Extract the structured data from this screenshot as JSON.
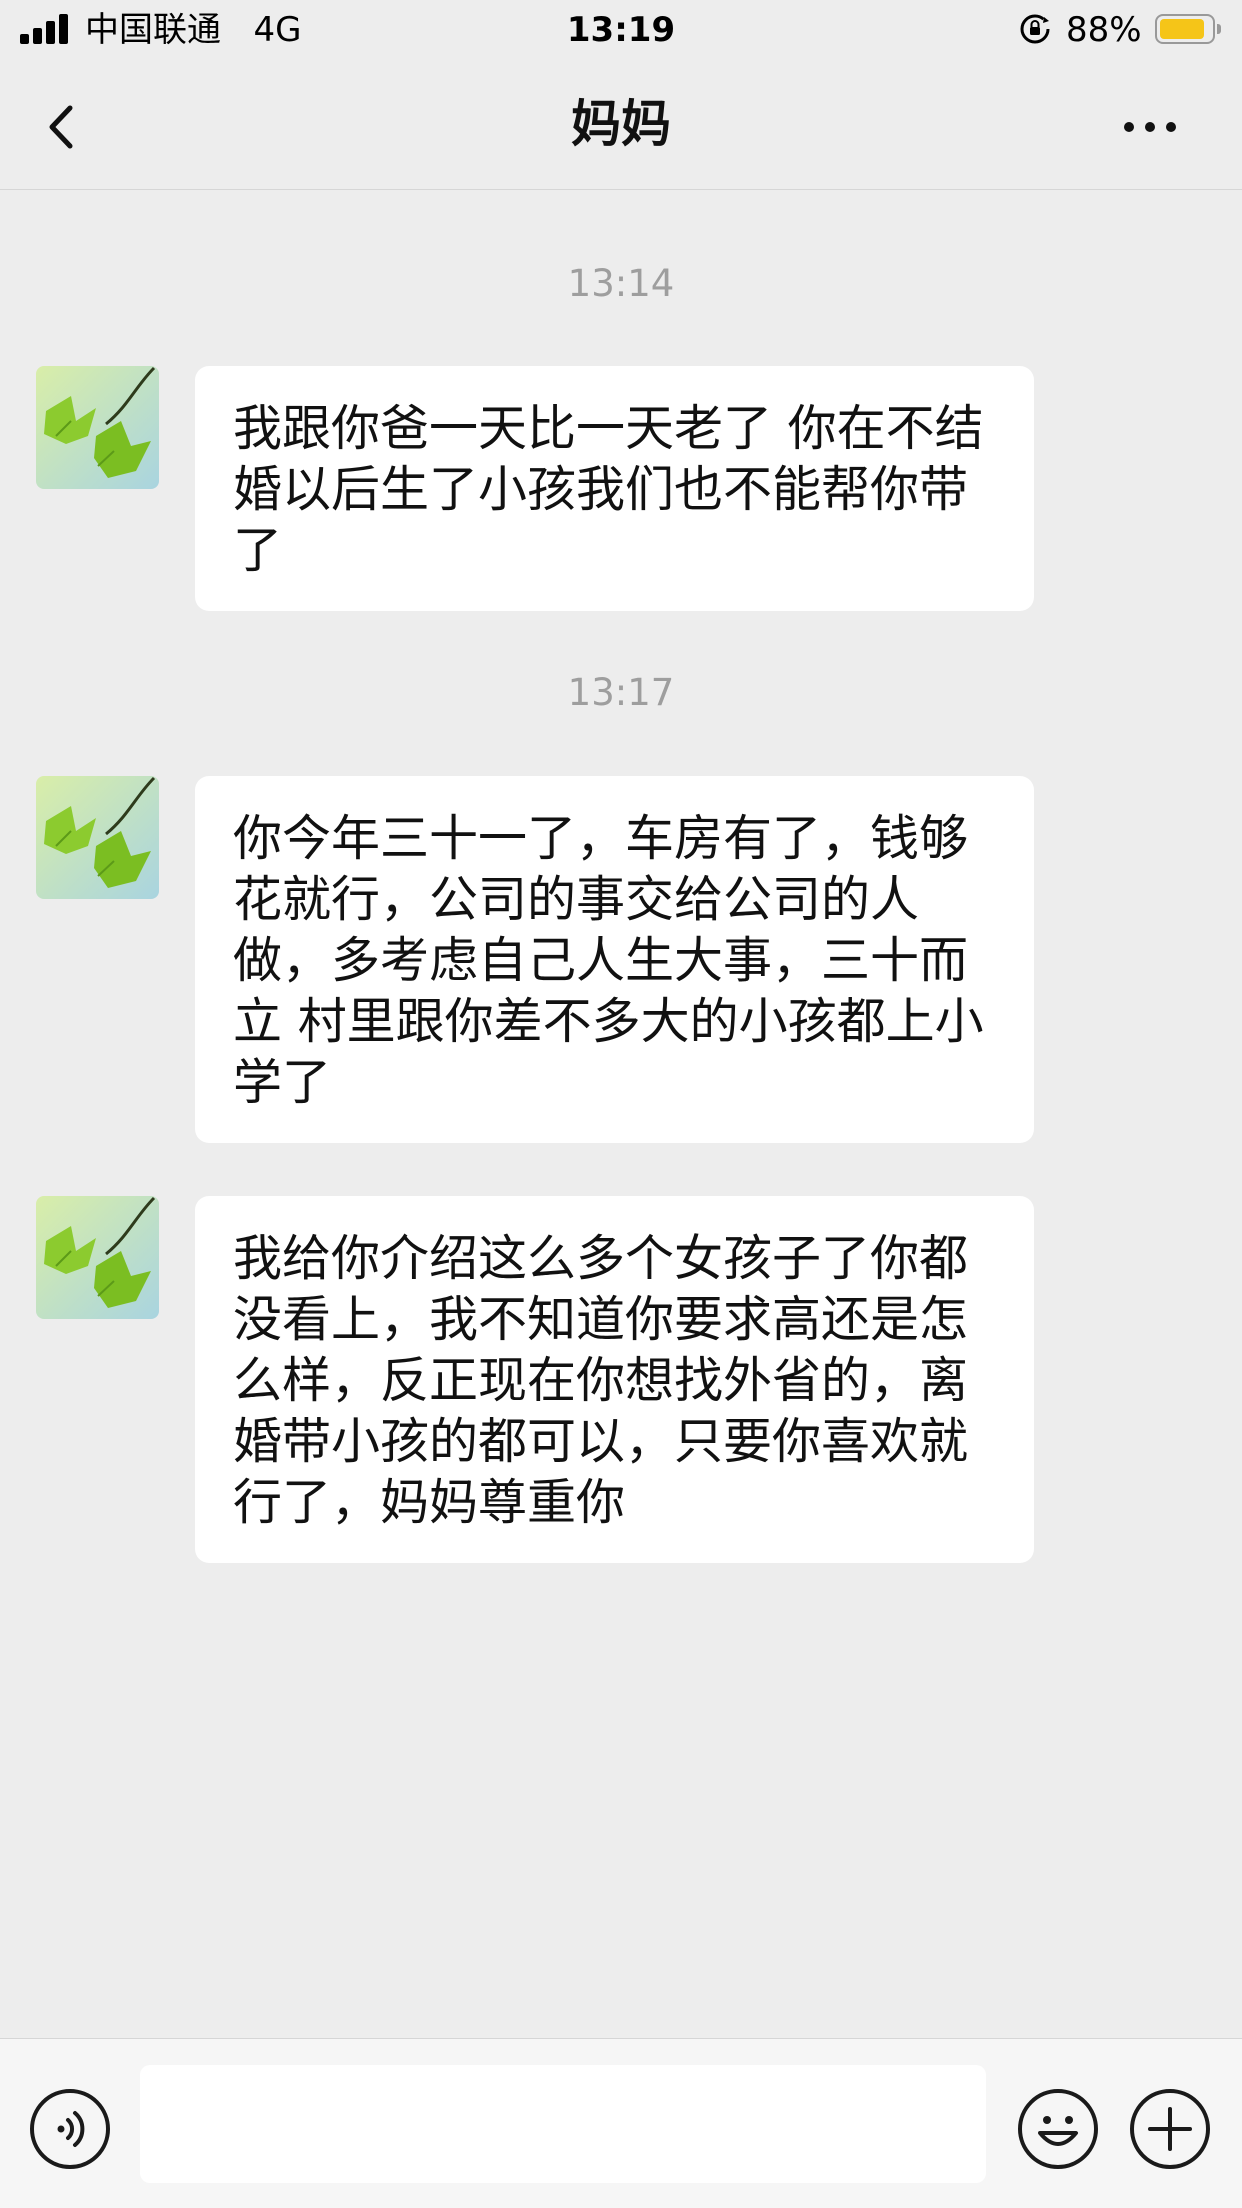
{
  "status_bar": {
    "carrier": "中国联通",
    "network": "4G",
    "time": "13:19",
    "battery_percent": "88%",
    "battery_level": 0.88,
    "battery_color": "#F5C518"
  },
  "nav": {
    "title": "妈妈",
    "back_icon": "chevron-left-icon",
    "more_icon": "more-dots-icon"
  },
  "messages": [
    {
      "timestamp": "13:14",
      "sender": "incoming",
      "text": "我跟你爸一天比一天老了 你在不结婚以后生了小孩我们也不能帮你带了"
    },
    {
      "timestamp": "13:17",
      "sender": "incoming",
      "text": "你今年三十一了，车房有了，钱够花就行，公司的事交给公司的人做，多考虑自己人生大事，三十而立 村里跟你差不多大的小孩都上小学了"
    },
    {
      "timestamp": "",
      "sender": "incoming",
      "text": "我给你介绍这么多个女孩子了你都没看上，我不知道你要求高还是怎么样，反正现在你想找外省的，离婚带小孩的都可以，只要你喜欢就行了，妈妈尊重你"
    }
  ],
  "input_bar": {
    "input_value": "",
    "voice_icon": "voice-icon",
    "emoji_icon": "emoji-icon",
    "plus_icon": "plus-icon"
  },
  "colors": {
    "background": "#EDEDED",
    "bubble": "#FFFFFF",
    "timestamp_text": "#9E9E9E"
  }
}
